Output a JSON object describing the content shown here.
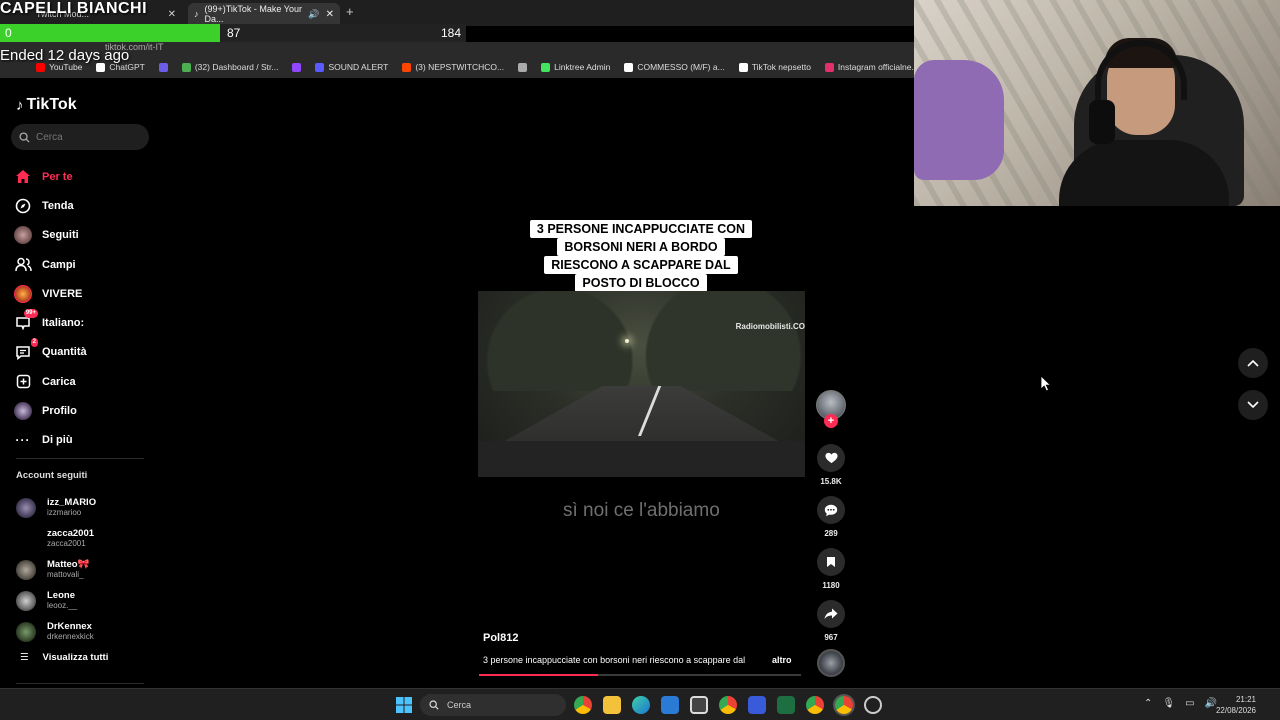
{
  "stream_overlay": {
    "title": "CAPELLI BIANCHI",
    "progress_start": "0",
    "progress_current": "87",
    "progress_goal": "184",
    "progress_fraction": 0.4728,
    "ended_text": "Ended 12 days ago"
  },
  "browser": {
    "tabs": [
      {
        "label": "Twitch Mod..."
      },
      {
        "label": "(99+)TikTok - Make Your Da..."
      }
    ],
    "url": "tiktok.com/it-IT",
    "bookmarks": [
      {
        "label": "YouTube",
        "color": "#ff0000"
      },
      {
        "label": "ChatGPT",
        "color": "#ffffff"
      },
      {
        "label": "",
        "color": "#6c5ce7"
      },
      {
        "label": "(32) Dashboard / Str...",
        "color": "#4caf50"
      },
      {
        "label": "",
        "color": "#9146ff"
      },
      {
        "label": "SOUND ALERT",
        "color": "#5a5aff"
      },
      {
        "label": "(3) NEPSTWITCHCO...",
        "color": "#ff4500"
      },
      {
        "label": "",
        "color": "#aaaaaa"
      },
      {
        "label": "Linktree Admin",
        "color": "#43e55e"
      },
      {
        "label": "COMMESSO (M/F) a...",
        "color": "#ffffff"
      },
      {
        "label": "TikTok nepsetto",
        "color": "#ffffff"
      },
      {
        "label": "Instagram officialne...",
        "color": "#e1306c"
      },
      {
        "label": "StartHouse",
        "color": "#cccccc"
      }
    ]
  },
  "sidebar": {
    "logo": "TikTok",
    "search_placeholder": "Cerca",
    "nav": [
      {
        "label": "Per te",
        "icon": "home-icon",
        "active": true
      },
      {
        "label": "Tenda",
        "icon": "compass-icon"
      },
      {
        "label": "Seguiti",
        "icon": "avatar"
      },
      {
        "label": "Campi",
        "icon": "users-icon"
      },
      {
        "label": "VIVERE",
        "icon": "live-avatar"
      },
      {
        "label": "Italiano:",
        "icon": "inbox-icon",
        "badge": "99+"
      },
      {
        "label": "Quantità",
        "icon": "message-icon",
        "badge": "2"
      },
      {
        "label": "Carica",
        "icon": "upload-icon"
      },
      {
        "label": "Profilo",
        "icon": "profile-avatar"
      },
      {
        "label": "Di più",
        "icon": "more-icon"
      }
    ],
    "accounts_title": "Account seguiti",
    "accounts": [
      {
        "name": "izz_MARIO",
        "handle": "izzmarioo"
      },
      {
        "name": "zacca2001",
        "handle": "zacca2001"
      },
      {
        "name": "Matteo🎀",
        "handle": "mattovali_"
      },
      {
        "name": "Leone",
        "handle": "leooz.__"
      },
      {
        "name": "DrKennex",
        "handle": "drkennexkick"
      }
    ],
    "see_all": "Visualizza tutti"
  },
  "video": {
    "caption_lines": [
      "3 PERSONE INCAPPUCCIATE CON",
      "BORSONI NERI A BORDO",
      "RIESCONO A SCAPPARE DAL",
      "POSTO DI BLOCCO"
    ],
    "watermark": "Radiomobilisti.CO",
    "subtitle": "sì noi ce l'abbiamo",
    "author": "Pol812",
    "description": "3 persone incappucciate con borsoni neri riescono a scappare dal",
    "more": "altro",
    "progress_fraction": 0.37,
    "likes": "15.8K",
    "comments": "289",
    "saves": "1180",
    "shares": "967"
  },
  "taskbar": {
    "search_placeholder": "Cerca",
    "time": "21:21",
    "date": "22/08/2026"
  },
  "colors": {
    "accent": "#fe2c55",
    "progress_green": "#3bd12a"
  }
}
